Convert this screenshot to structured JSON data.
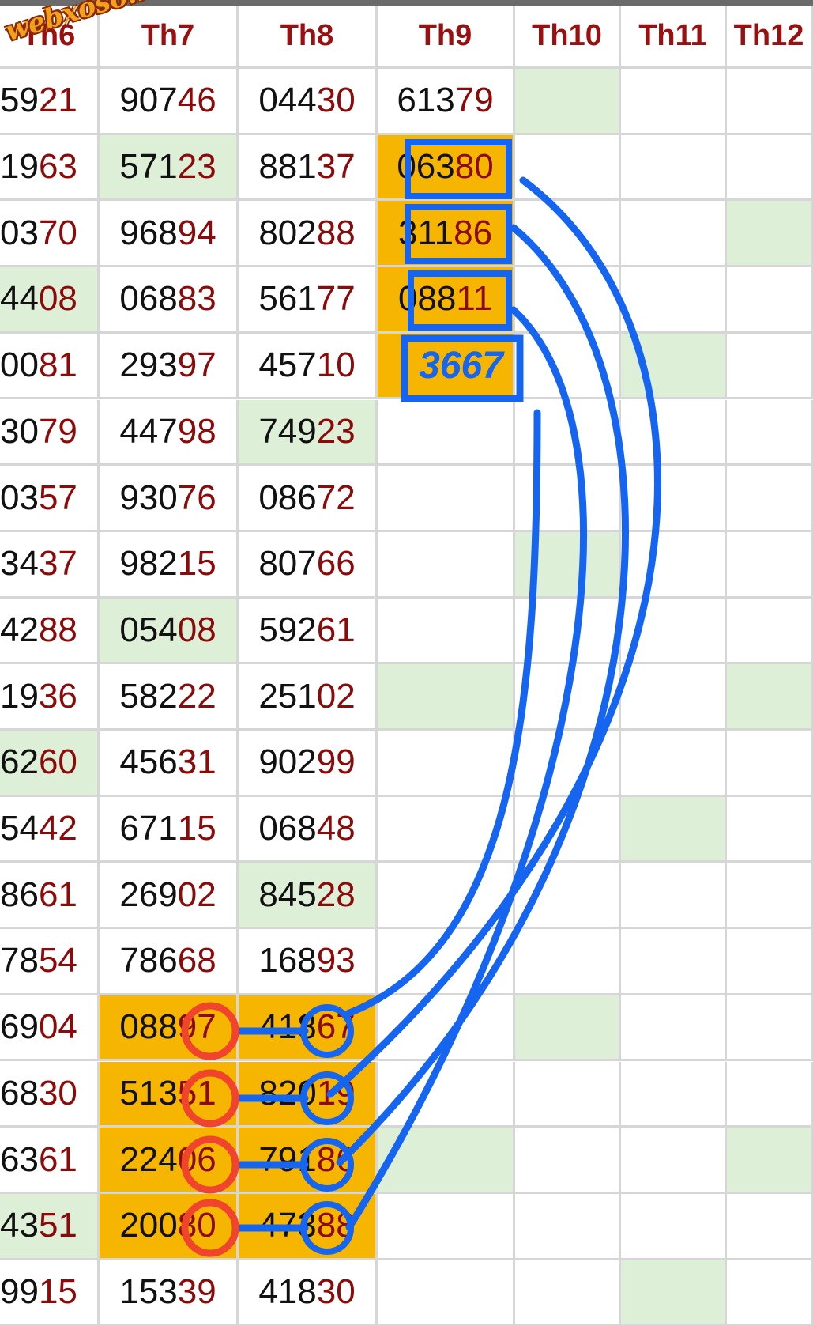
{
  "watermark": "webxoso.net",
  "headers": [
    "Th6",
    "Th7",
    "Th8",
    "Th9",
    "Th10",
    "Th11",
    "Th12"
  ],
  "rows": [
    [
      "5921",
      "90746",
      "04430",
      "61379",
      "",
      "",
      ""
    ],
    [
      "1963",
      "57123",
      "88137",
      "06380",
      "",
      "",
      ""
    ],
    [
      "0370",
      "96894",
      "80288",
      "31186",
      "",
      "",
      ""
    ],
    [
      "4408",
      "06883",
      "56177",
      "08811",
      "",
      "",
      ""
    ],
    [
      "0081",
      "29397",
      "45710",
      "3667",
      "",
      "",
      ""
    ],
    [
      "3079",
      "44798",
      "74923",
      "",
      "",
      "",
      ""
    ],
    [
      "0357",
      "93076",
      "08672",
      "",
      "",
      "",
      ""
    ],
    [
      "3437",
      "98215",
      "80766",
      "",
      "",
      "",
      ""
    ],
    [
      "4288",
      "05408",
      "59261",
      "",
      "",
      "",
      ""
    ],
    [
      "1936",
      "58222",
      "25102",
      "",
      "",
      "",
      ""
    ],
    [
      "6260",
      "45631",
      "90299",
      "",
      "",
      "",
      ""
    ],
    [
      "5442",
      "67115",
      "06848",
      "",
      "",
      "",
      ""
    ],
    [
      "8661",
      "26902",
      "84528",
      "",
      "",
      "",
      ""
    ],
    [
      "7854",
      "78668",
      "16893",
      "",
      "",
      "",
      ""
    ],
    [
      "6904",
      "08897",
      "41867",
      "",
      "",
      "",
      ""
    ],
    [
      "6830",
      "51351",
      "82019",
      "",
      "",
      "",
      ""
    ],
    [
      "6361",
      "22406",
      "79186",
      "",
      "",
      "",
      ""
    ],
    [
      "4351",
      "20080",
      "47388",
      "",
      "",
      "",
      ""
    ],
    [
      "9915",
      "15339",
      "41830",
      "",
      "",
      "",
      ""
    ]
  ],
  "green_cells": [
    [
      0,
      4
    ],
    [
      1,
      1
    ],
    [
      2,
      6
    ],
    [
      3,
      0
    ],
    [
      4,
      5
    ],
    [
      5,
      2
    ],
    [
      7,
      4
    ],
    [
      8,
      1
    ],
    [
      9,
      3
    ],
    [
      9,
      6
    ],
    [
      10,
      0
    ],
    [
      11,
      5
    ],
    [
      12,
      2
    ],
    [
      14,
      4
    ],
    [
      16,
      3
    ],
    [
      16,
      6
    ],
    [
      17,
      0
    ],
    [
      18,
      5
    ]
  ],
  "orange_cells": [
    [
      1,
      3
    ],
    [
      2,
      3
    ],
    [
      3,
      3
    ],
    [
      4,
      3
    ],
    [
      14,
      1
    ],
    [
      14,
      2
    ],
    [
      15,
      1
    ],
    [
      15,
      2
    ],
    [
      16,
      1
    ],
    [
      16,
      2
    ],
    [
      17,
      1
    ],
    [
      17,
      2
    ]
  ],
  "colors": {
    "header_text": "#9a0f0f",
    "red_digits": "#8b0a0a",
    "green_highlight": "#deefd8",
    "orange_highlight": "#f6b500",
    "blue_annotation": "#1565f0",
    "red_annotation": "#f0442c",
    "grid_line": "#d6d6d6"
  }
}
